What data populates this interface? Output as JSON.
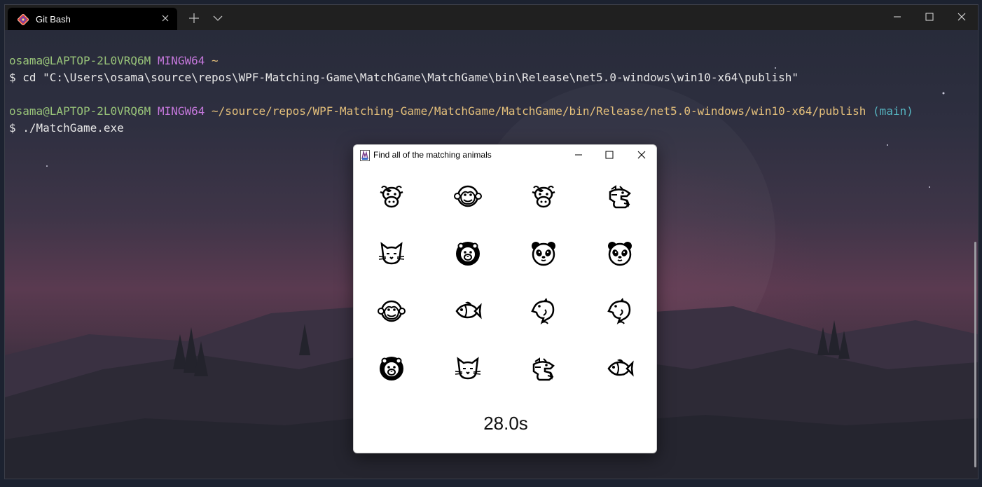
{
  "terminal": {
    "tab_title": "Git Bash",
    "tab_icon": "git-icon",
    "lines": [
      [],
      [
        {
          "text": "osama@LAPTOP-2L0VRQ6M",
          "color": "#98c379"
        },
        {
          "text": " "
        },
        {
          "text": "MINGW64",
          "color": "#c678dd"
        },
        {
          "text": " "
        },
        {
          "text": "~",
          "color": "#e5c07b"
        }
      ],
      [
        {
          "text": "$ cd \"C:\\Users\\osama\\source\\repos\\WPF-Matching-Game\\MatchGame\\MatchGame\\bin\\Release\\net5.0-windows\\win10-x64\\publish\""
        }
      ],
      [],
      [
        {
          "text": "osama@LAPTOP-2L0VRQ6M",
          "color": "#98c379"
        },
        {
          "text": " "
        },
        {
          "text": "MINGW64",
          "color": "#c678dd"
        },
        {
          "text": " "
        },
        {
          "text": "~/source/repos/WPF-Matching-Game/MatchGame/MatchGame/bin/Release/net5.0-windows/win10-x64/publish",
          "color": "#e5c07b"
        },
        {
          "text": " "
        },
        {
          "text": "(main)",
          "color": "#56b6c2"
        }
      ],
      [
        {
          "text": "$ ./MatchGame.exe"
        }
      ]
    ]
  },
  "game": {
    "title": "Find all of the matching animals",
    "timer": "28.0s",
    "cells": [
      "cow-icon",
      "monkey-icon",
      "cow-icon",
      "dragon-icon",
      "cat-icon",
      "lion-icon",
      "panda-icon",
      "panda-icon",
      "monkey-icon",
      "fish-icon",
      "dolphin-icon",
      "dolphin-icon",
      "lion-icon",
      "cat-icon",
      "dragon-icon",
      "fish-icon"
    ]
  }
}
